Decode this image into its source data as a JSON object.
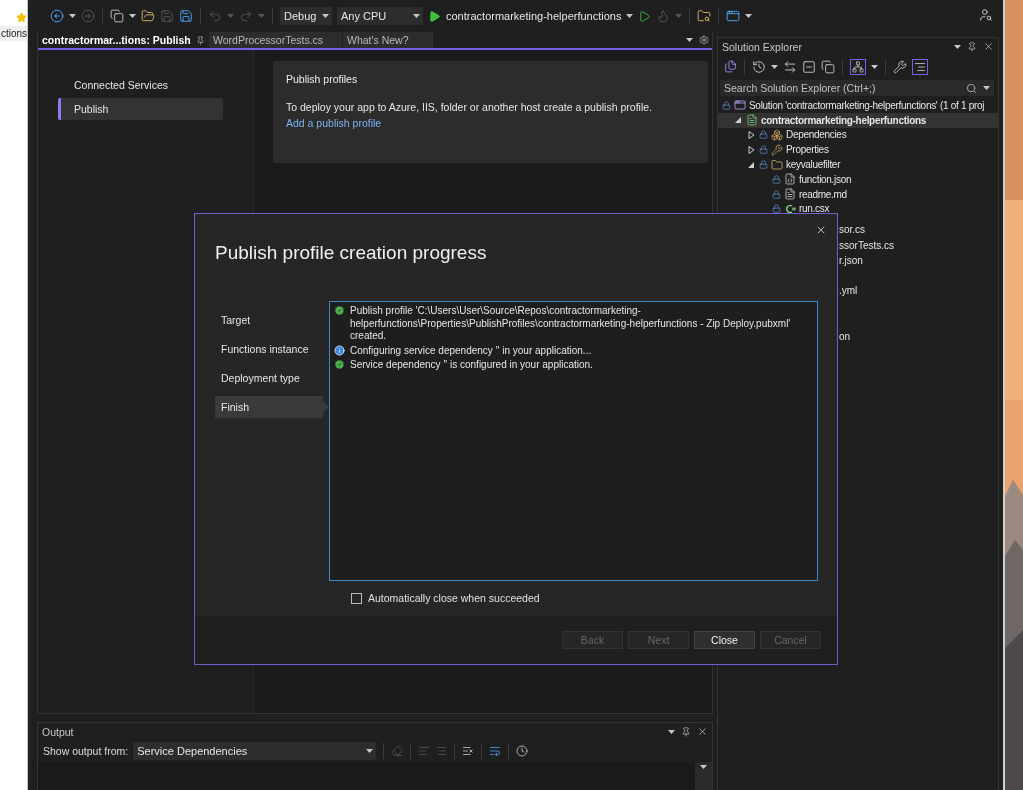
{
  "browser_strip": {
    "label": "ctions"
  },
  "toolbar": {
    "configuration": "Debug",
    "platform": "Any CPU",
    "startup": "contractormarketing-helperfunctions"
  },
  "tabs": [
    {
      "label": "contractormar...tions: Publish",
      "selected": true
    },
    {
      "label": "WordProcessorTests.cs",
      "selected": false
    },
    {
      "label": "What's New?",
      "selected": false
    }
  ],
  "publish_page": {
    "nav": [
      {
        "label": "Connected Services",
        "selected": false
      },
      {
        "label": "Publish",
        "selected": true
      }
    ],
    "card": {
      "title": "Publish profiles",
      "description": "To deploy your app to Azure, IIS, folder or another host create a publish profile.",
      "link": "Add a publish profile"
    }
  },
  "solution_explorer": {
    "title": "Solution Explorer",
    "search": {
      "placeholder": "Search Solution Explorer (Ctrl+;)"
    },
    "tree": [
      {
        "label": "Solution 'contractormarketing-helperfunctions' (1 of 1 proj",
        "kind": "solution",
        "selected": false,
        "children": [
          {
            "label": "contractormarketing-helperfunctions",
            "kind": "project",
            "expanded": true,
            "selected": true,
            "children": [
              {
                "label": "Dependencies",
                "kind": "dependencies",
                "expanded": false,
                "selected": false
              },
              {
                "label": "Properties",
                "kind": "properties",
                "expanded": false,
                "selected": false
              },
              {
                "label": "keyvaluefilter",
                "kind": "folder",
                "expanded": true,
                "selected": false,
                "children": [
                  {
                    "label": "function.json",
                    "kind": "json",
                    "selected": false
                  },
                  {
                    "label": "readme.md",
                    "kind": "markdown",
                    "selected": false
                  },
                  {
                    "label": "run.csx",
                    "kind": "csharp",
                    "selected": false
                  }
                ]
              }
            ]
          }
        ]
      }
    ],
    "covered_items": [
      {
        "label": "sor.cs"
      },
      {
        "label": "ssorTests.cs"
      },
      {
        "label": "r.json"
      },
      {
        "label": ".yml"
      },
      {
        "label": "on"
      }
    ]
  },
  "output": {
    "title": "Output",
    "label": "Show output from:",
    "source": "Service Dependencies"
  },
  "dialog": {
    "title": "Publish profile creation progress",
    "steps": [
      {
        "label": "Target",
        "selected": false
      },
      {
        "label": "Functions instance",
        "selected": false
      },
      {
        "label": "Deployment type",
        "selected": false
      },
      {
        "label": "Finish",
        "selected": true
      }
    ],
    "log": [
      {
        "kind": "success",
        "text": "Publish profile 'C:\\Users\\User\\Source\\Repos\\contractormarketing-helperfunctions\\Properties\\PublishProfiles\\contractormarketing-helperfunctions - Zip Deploy.pubxml' created."
      },
      {
        "kind": "info",
        "text": "Configuring service dependency '' in your application..."
      },
      {
        "kind": "success",
        "text": "Service dependency '' is configured in your application."
      }
    ],
    "auto_close": {
      "label": "Automatically close when succeeded",
      "checked": false
    },
    "buttons": [
      {
        "label": "Back",
        "disabled": true
      },
      {
        "label": "Next",
        "disabled": true
      },
      {
        "label": "Close",
        "disabled": false
      },
      {
        "label": "Cancel",
        "disabled": true
      }
    ]
  }
}
